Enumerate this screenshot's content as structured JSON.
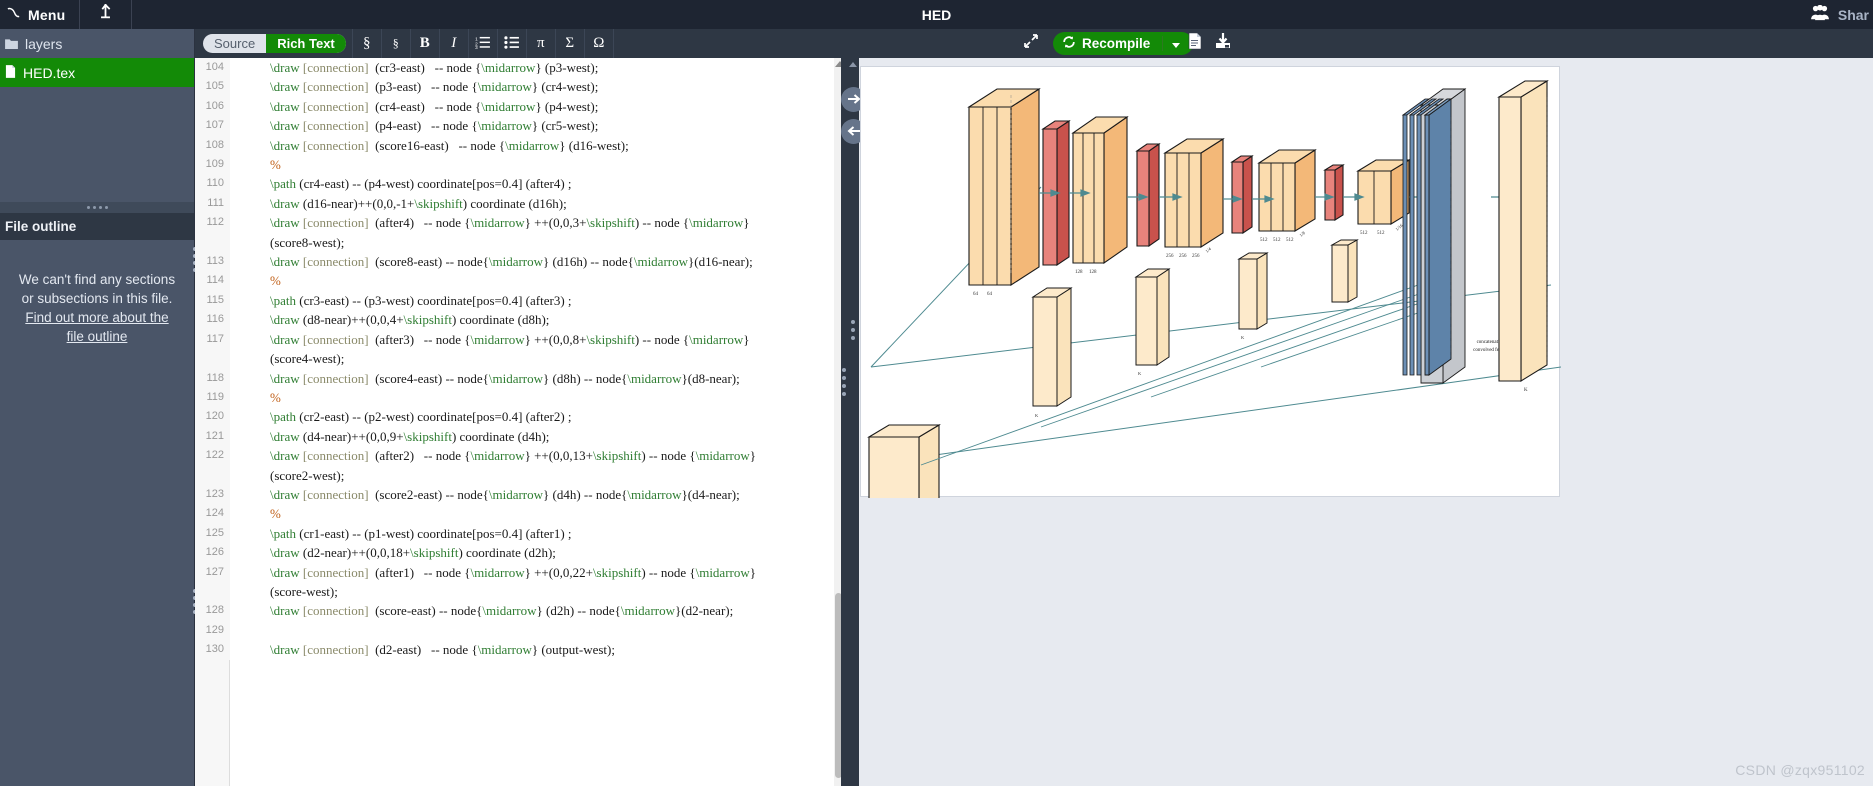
{
  "topbar": {
    "menu_label": "Menu",
    "upload_icon": "upload-icon",
    "project_title": "HED",
    "share_label": "Shar",
    "share_icon": "people-icon"
  },
  "sidebar": {
    "files": [
      {
        "name": "layers",
        "type": "folder",
        "selected": false,
        "icon": "folder-icon"
      },
      {
        "name": "HED.tex",
        "type": "file",
        "selected": true,
        "icon": "file-icon"
      }
    ],
    "outline": {
      "header": "File outline",
      "empty_message": "We can't find any sections or subsections in this file.",
      "link_text": "Find out more about the file outline"
    }
  },
  "editor_toolbar": {
    "modes": [
      {
        "label": "Source",
        "active": false
      },
      {
        "label": "Rich Text",
        "active": true
      }
    ],
    "buttons": [
      {
        "icon": "section-icon",
        "glyph": "§",
        "name": "section-button"
      },
      {
        "icon": "subsection-icon",
        "glyph": "§",
        "name": "subsection-button"
      },
      {
        "icon": "bold-icon",
        "glyph": "B",
        "name": "bold-button"
      },
      {
        "icon": "italic-icon",
        "glyph": "I",
        "name": "italic-button"
      },
      {
        "icon": "numbered-list-icon",
        "glyph": "",
        "name": "numbered-list-button"
      },
      {
        "icon": "bullet-list-icon",
        "glyph": "",
        "name": "bullet-list-button"
      },
      {
        "icon": "math-pi-icon",
        "glyph": "π",
        "name": "inline-math-button"
      },
      {
        "icon": "math-sigma-icon",
        "glyph": "Σ",
        "name": "display-math-button"
      },
      {
        "icon": "math-omega-icon",
        "glyph": "Ω",
        "name": "symbol-button"
      }
    ]
  },
  "pdf_toolbar": {
    "expand_icon": "expand-arrows-icon",
    "recompile_label": "Recompile",
    "recompile_icon": "refresh-icon",
    "caret_icon": "chevron-down-icon",
    "logs_icon": "document-icon",
    "download_icon": "download-icon"
  },
  "pdf_nav": {
    "next_icon": "arrow-right-circle-icon",
    "prev_icon": "arrow-left-circle-icon"
  },
  "code": {
    "lines": [
      {
        "num": "104",
        "segments": [
          {
            "t": "\\draw ",
            "c": "cmd"
          },
          {
            "t": "[connection]",
            "c": "opt"
          },
          {
            "t": "  (cr3-east)   -- node {",
            "c": ""
          },
          {
            "t": "\\midarrow",
            "c": "grn"
          },
          {
            "t": "} (p3-west);",
            "c": ""
          }
        ]
      },
      {
        "num": "105",
        "segments": [
          {
            "t": "\\draw ",
            "c": "cmd"
          },
          {
            "t": "[connection]",
            "c": "opt"
          },
          {
            "t": "  (p3-east)   -- node {",
            "c": ""
          },
          {
            "t": "\\midarrow",
            "c": "grn"
          },
          {
            "t": "} (cr4-west);",
            "c": ""
          }
        ]
      },
      {
        "num": "106",
        "segments": [
          {
            "t": "\\draw ",
            "c": "cmd"
          },
          {
            "t": "[connection]",
            "c": "opt"
          },
          {
            "t": "  (cr4-east)   -- node {",
            "c": ""
          },
          {
            "t": "\\midarrow",
            "c": "grn"
          },
          {
            "t": "} (p4-west);",
            "c": ""
          }
        ]
      },
      {
        "num": "107",
        "segments": [
          {
            "t": "\\draw ",
            "c": "cmd"
          },
          {
            "t": "[connection]",
            "c": "opt"
          },
          {
            "t": "  (p4-east)   -- node {",
            "c": ""
          },
          {
            "t": "\\midarrow",
            "c": "grn"
          },
          {
            "t": "} (cr5-west);",
            "c": ""
          }
        ]
      },
      {
        "num": "108",
        "segments": [
          {
            "t": "\\draw ",
            "c": "cmd"
          },
          {
            "t": "[connection]",
            "c": "opt"
          },
          {
            "t": "  (score16-east)   -- node {",
            "c": ""
          },
          {
            "t": "\\midarrow",
            "c": "grn"
          },
          {
            "t": "} (d16-west);",
            "c": ""
          }
        ]
      },
      {
        "num": "109",
        "segments": [
          {
            "t": "%",
            "c": "cmt"
          }
        ]
      },
      {
        "num": "110",
        "segments": [
          {
            "t": "\\path ",
            "c": "cmd"
          },
          {
            "t": "(cr4-east) -- (p4-west) coordinate[pos=0.4] (after4) ;",
            "c": ""
          }
        ]
      },
      {
        "num": "111",
        "segments": [
          {
            "t": "\\draw ",
            "c": "cmd"
          },
          {
            "t": "(d16-near)++(0,0,-1+",
            "c": ""
          },
          {
            "t": "\\skipshift",
            "c": "grn"
          },
          {
            "t": ") coordinate (d16h);",
            "c": ""
          }
        ]
      },
      {
        "num": "112",
        "segments": [
          {
            "t": "\\draw ",
            "c": "cmd"
          },
          {
            "t": "[connection]",
            "c": "opt"
          },
          {
            "t": "  (after4)   -- node {",
            "c": ""
          },
          {
            "t": "\\midarrow",
            "c": "grn"
          },
          {
            "t": "} ++(0,0,3+",
            "c": ""
          },
          {
            "t": "\\skipshift",
            "c": "grn"
          },
          {
            "t": ") -- node {",
            "c": ""
          },
          {
            "t": "\\midarrow",
            "c": "grn"
          },
          {
            "t": "}\n(score8-west);",
            "c": ""
          }
        ]
      },
      {
        "num": "113",
        "segments": [
          {
            "t": "\\draw ",
            "c": "cmd"
          },
          {
            "t": "[connection]",
            "c": "opt"
          },
          {
            "t": "  (score8-east) -- node{",
            "c": ""
          },
          {
            "t": "\\midarrow",
            "c": "grn"
          },
          {
            "t": "} (d16h) -- node{",
            "c": ""
          },
          {
            "t": "\\midarrow",
            "c": "grn"
          },
          {
            "t": "}(d16-near);",
            "c": ""
          }
        ]
      },
      {
        "num": "114",
        "segments": [
          {
            "t": "%",
            "c": "cmt"
          }
        ]
      },
      {
        "num": "115",
        "segments": [
          {
            "t": "\\path ",
            "c": "cmd"
          },
          {
            "t": "(cr3-east) -- (p3-west) coordinate[pos=0.4] (after3) ;",
            "c": ""
          }
        ]
      },
      {
        "num": "116",
        "segments": [
          {
            "t": "\\draw ",
            "c": "cmd"
          },
          {
            "t": "(d8-near)++(0,0,4+",
            "c": ""
          },
          {
            "t": "\\skipshift",
            "c": "grn"
          },
          {
            "t": ") coordinate (d8h);",
            "c": ""
          }
        ]
      },
      {
        "num": "117",
        "segments": [
          {
            "t": "\\draw ",
            "c": "cmd"
          },
          {
            "t": "[connection]",
            "c": "opt"
          },
          {
            "t": "  (after3)   -- node {",
            "c": ""
          },
          {
            "t": "\\midarrow",
            "c": "grn"
          },
          {
            "t": "} ++(0,0,8+",
            "c": ""
          },
          {
            "t": "\\skipshift",
            "c": "grn"
          },
          {
            "t": ") -- node {",
            "c": ""
          },
          {
            "t": "\\midarrow",
            "c": "grn"
          },
          {
            "t": "}\n(score4-west);",
            "c": ""
          }
        ]
      },
      {
        "num": "118",
        "segments": [
          {
            "t": "\\draw ",
            "c": "cmd"
          },
          {
            "t": "[connection]",
            "c": "opt"
          },
          {
            "t": "  (score4-east) -- node{",
            "c": ""
          },
          {
            "t": "\\midarrow",
            "c": "grn"
          },
          {
            "t": "} (d8h) -- node{",
            "c": ""
          },
          {
            "t": "\\midarrow",
            "c": "grn"
          },
          {
            "t": "}(d8-near);",
            "c": ""
          }
        ]
      },
      {
        "num": "119",
        "segments": [
          {
            "t": "%",
            "c": "cmt"
          }
        ]
      },
      {
        "num": "120",
        "segments": [
          {
            "t": "\\path ",
            "c": "cmd"
          },
          {
            "t": "(cr2-east) -- (p2-west) coordinate[pos=0.4] (after2) ;",
            "c": ""
          }
        ]
      },
      {
        "num": "121",
        "segments": [
          {
            "t": "\\draw ",
            "c": "cmd"
          },
          {
            "t": "(d4-near)++(0,0,9+",
            "c": ""
          },
          {
            "t": "\\skipshift",
            "c": "grn"
          },
          {
            "t": ") coordinate (d4h);",
            "c": ""
          }
        ]
      },
      {
        "num": "122",
        "segments": [
          {
            "t": "\\draw ",
            "c": "cmd"
          },
          {
            "t": "[connection]",
            "c": "opt"
          },
          {
            "t": "  (after2)   -- node {",
            "c": ""
          },
          {
            "t": "\\midarrow",
            "c": "grn"
          },
          {
            "t": "} ++(0,0,13+",
            "c": ""
          },
          {
            "t": "\\skipshift",
            "c": "grn"
          },
          {
            "t": ") -- node {",
            "c": ""
          },
          {
            "t": "\\midarrow",
            "c": "grn"
          },
          {
            "t": "}\n(score2-west);",
            "c": ""
          }
        ]
      },
      {
        "num": "123",
        "segments": [
          {
            "t": "\\draw ",
            "c": "cmd"
          },
          {
            "t": "[connection]",
            "c": "opt"
          },
          {
            "t": "  (score2-east) -- node{",
            "c": ""
          },
          {
            "t": "\\midarrow",
            "c": "grn"
          },
          {
            "t": "} (d4h) -- node{",
            "c": ""
          },
          {
            "t": "\\midarrow",
            "c": "grn"
          },
          {
            "t": "}(d4-near);",
            "c": ""
          }
        ]
      },
      {
        "num": "124",
        "segments": [
          {
            "t": "%",
            "c": "cmt"
          }
        ]
      },
      {
        "num": "125",
        "segments": [
          {
            "t": "\\path ",
            "c": "cmd"
          },
          {
            "t": "(cr1-east) -- (p1-west) coordinate[pos=0.4] (after1) ;",
            "c": ""
          }
        ]
      },
      {
        "num": "126",
        "segments": [
          {
            "t": "\\draw ",
            "c": "cmd"
          },
          {
            "t": "(d2-near)++(0,0,18+",
            "c": ""
          },
          {
            "t": "\\skipshift",
            "c": "grn"
          },
          {
            "t": ") coordinate (d2h);",
            "c": ""
          }
        ]
      },
      {
        "num": "127",
        "segments": [
          {
            "t": "\\draw ",
            "c": "cmd"
          },
          {
            "t": "[connection]",
            "c": "opt"
          },
          {
            "t": "  (after1)   -- node {",
            "c": ""
          },
          {
            "t": "\\midarrow",
            "c": "grn"
          },
          {
            "t": "} ++(0,0,22+",
            "c": ""
          },
          {
            "t": "\\skipshift",
            "c": "grn"
          },
          {
            "t": ") -- node {",
            "c": ""
          },
          {
            "t": "\\midarrow",
            "c": "grn"
          },
          {
            "t": "}\n(score-west);",
            "c": ""
          }
        ]
      },
      {
        "num": "128",
        "segments": [
          {
            "t": "\\draw ",
            "c": "cmd"
          },
          {
            "t": "[connection]",
            "c": "opt"
          },
          {
            "t": "  (score-east) -- node{",
            "c": ""
          },
          {
            "t": "\\midarrow",
            "c": "grn"
          },
          {
            "t": "} (d2h) -- node{",
            "c": ""
          },
          {
            "t": "\\midarrow",
            "c": "grn"
          },
          {
            "t": "}(d2-near);",
            "c": ""
          }
        ]
      },
      {
        "num": "129",
        "segments": [
          {
            "t": "",
            "c": ""
          }
        ]
      },
      {
        "num": "130",
        "segments": [
          {
            "t": "\\draw ",
            "c": "cmd"
          },
          {
            "t": "[connection]",
            "c": "opt"
          },
          {
            "t": "  (d2-east)   -- node {",
            "c": ""
          },
          {
            "t": "\\midarrow",
            "c": "grn"
          },
          {
            "t": "} (output-west);",
            "c": ""
          }
        ]
      }
    ]
  },
  "figure": {
    "annotation": "concatenation of de-convolved feature maps",
    "block_labels": [
      "64",
      "64",
      "128",
      "128",
      "256",
      "256",
      "256",
      "512",
      "512",
      "512",
      "512",
      "512"
    ],
    "scale_labels": [
      "1/2",
      "1/4",
      "1/8",
      "1/16"
    ],
    "side_labels": [
      "K",
      "K",
      "K",
      "K",
      "K"
    ]
  },
  "watermark": "CSDN @zqx951102",
  "colors": {
    "accent_green": "#138a07",
    "topbar_bg": "#1e2532",
    "sidebar_bg": "#4a5568",
    "toolbar_bg": "#2e3744",
    "pdf_bg": "#e7eaf0",
    "conv_orange": "#f7c99b",
    "pool_red": "#d96a60",
    "deconv_blue": "#5b84ad",
    "arrow_teal": "#3f7f87"
  }
}
